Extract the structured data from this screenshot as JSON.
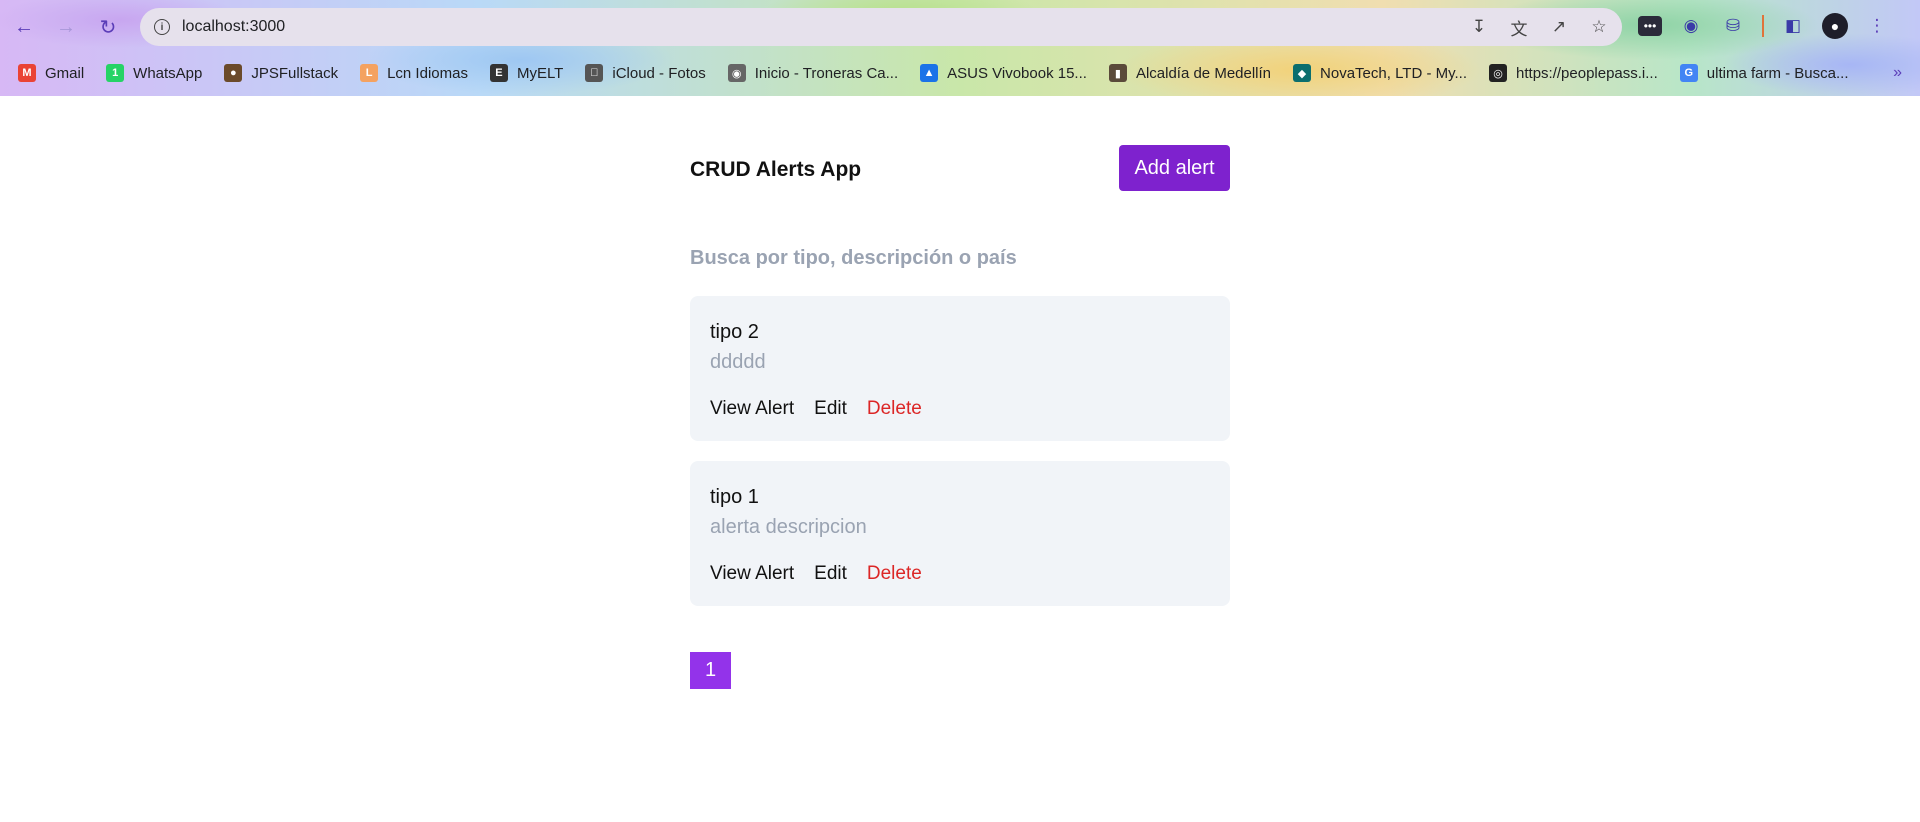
{
  "browser": {
    "url": "localhost:3000",
    "bookmarks": [
      {
        "label": "Gmail",
        "icon": "gmail-icon",
        "color": "#ea4335"
      },
      {
        "label": "WhatsApp",
        "icon": "whatsapp-icon",
        "color": "#25d366"
      },
      {
        "label": "JPSFullstack",
        "icon": "person-icon",
        "color": "#6b4a2a"
      },
      {
        "label": "Lcn Idiomas",
        "icon": "lcn-icon",
        "color": "#f4a261"
      },
      {
        "label": "MyELT",
        "icon": "myelt-icon",
        "color": "#333333"
      },
      {
        "label": "iCloud - Fotos",
        "icon": "apple-icon",
        "color": "#555555"
      },
      {
        "label": "Inicio - Troneras Ca...",
        "icon": "globe-icon",
        "color": "#666666"
      },
      {
        "label": "ASUS Vivobook 15...",
        "icon": "asus-icon",
        "color": "#1a73e8"
      },
      {
        "label": "Alcaldía de Medellín",
        "icon": "alcaldia-icon",
        "color": "#5a4a3a"
      },
      {
        "label": "NovaTech, LTD - My...",
        "icon": "novatech-icon",
        "color": "#0b6e6e"
      },
      {
        "label": "https://peoplepass.i...",
        "icon": "peoplepass-icon",
        "color": "#222222"
      },
      {
        "label": "ultima farm - Busca...",
        "icon": "google-icon",
        "color": "#4285f4"
      }
    ]
  },
  "app": {
    "title": "CRUD Alerts App",
    "add_button": "Add alert",
    "search_placeholder": "Busca por tipo, descripción o país",
    "alerts": [
      {
        "title": "tipo 2",
        "description": "ddddd",
        "view": "View Alert",
        "edit": "Edit",
        "delete": "Delete"
      },
      {
        "title": "tipo 1",
        "description": "alerta descripcion",
        "view": "View Alert",
        "edit": "Edit",
        "delete": "Delete"
      }
    ],
    "pagination": [
      "1"
    ]
  },
  "colors": {
    "primary": "#7e22ce",
    "page_button": "#9333ea",
    "delete": "#dc2626",
    "card_bg": "#f1f4f8"
  }
}
